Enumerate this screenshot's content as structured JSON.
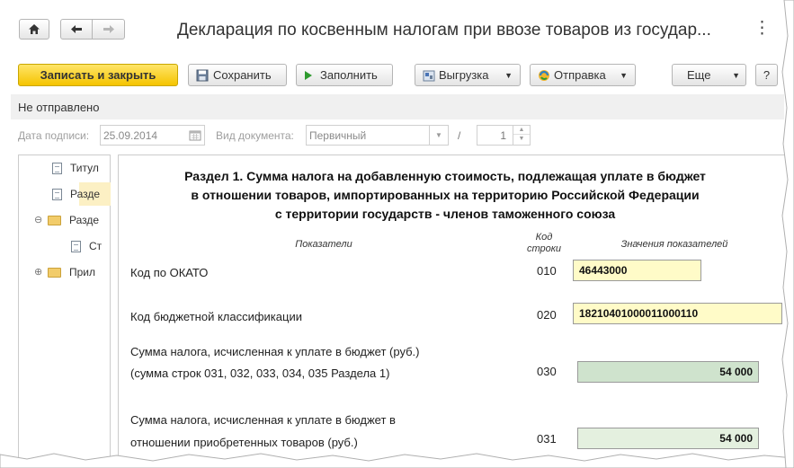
{
  "window": {
    "title": "Декларация по косвенным налогам при ввозе товаров из государ...",
    "more": "⋮"
  },
  "nav": {
    "home_icon": "home-icon",
    "back_icon": "arrow-left-icon",
    "forward_icon": "arrow-right-icon"
  },
  "toolbar": {
    "write_close": "Записать и закрыть",
    "save": "Сохранить",
    "fill": "Заполнить",
    "export": "Выгрузка",
    "send": "Отправка",
    "more": "Еще",
    "help": "?"
  },
  "status": "Не отправлено",
  "sign_date_label": "Дата подписи:",
  "sign_date_value": "25.09.2014",
  "doc_type_label": "Вид документа:",
  "doc_type_value": "Первичный",
  "slash": "/",
  "correction_number": "1",
  "tree": [
    {
      "label": "Титул",
      "icon": "document-icon"
    },
    {
      "label": "Разде",
      "icon": "document-icon"
    },
    {
      "label": "Разде",
      "icon": "folder-icon",
      "expander": "⊖"
    },
    {
      "label": "Ст",
      "icon": "document-icon"
    },
    {
      "label": "Прил",
      "icon": "folder-icon",
      "expander": "⊕"
    }
  ],
  "section": {
    "title_line1": "Раздел 1. Сумма налога на добавленную стоимость, подлежащая уплате в бюджет",
    "title_line2": "в отношении товаров, импортированных на территорию Российской Федерации",
    "title_line3": "с территории государств - членов таможенного союза",
    "col_indicators": "Показатели",
    "col_code_1": "Код",
    "col_code_2": "строки",
    "col_values": "Значения показателей"
  },
  "rows": [
    {
      "label1": "Код по ОКАТО",
      "label2": "",
      "code": "010",
      "value": "46443000"
    },
    {
      "label1": "Код бюджетной классификации",
      "label2": "",
      "code": "020",
      "value": "18210401000011000110"
    },
    {
      "label1": "Сумма налога, исчисленная к уплате в бюджет (руб.)",
      "label2": "(сумма строк 031, 032, 033, 034, 035 Раздела 1)",
      "code": "030",
      "value": "54 000"
    },
    {
      "label1": "Сумма налога, исчисленная к уплате в бюджет в",
      "label2": "отношении приобретенных товаров (руб.)",
      "code": "031",
      "value": "54 000"
    }
  ],
  "colors": {
    "primary_button": "#f5c400",
    "input_yellow": "#fffbc8",
    "value_green": "#cfe3cd",
    "selection": "#fcf0c4"
  }
}
